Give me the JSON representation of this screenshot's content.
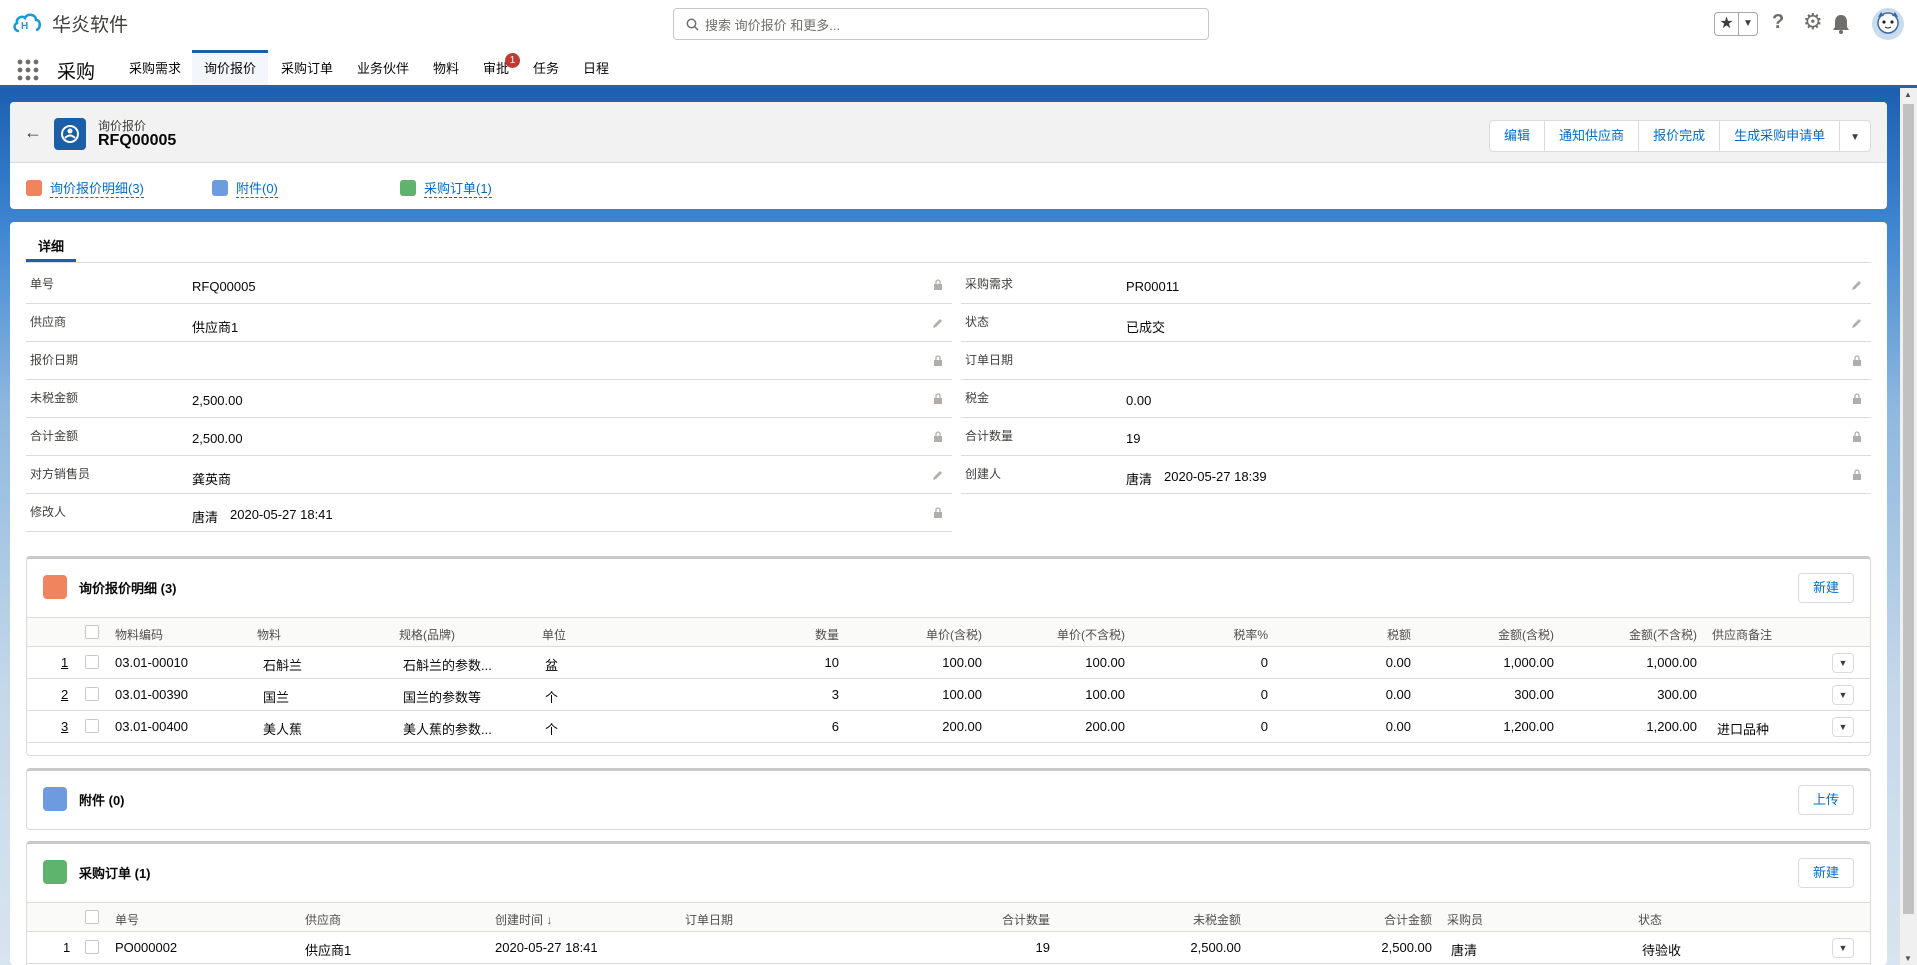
{
  "app": {
    "logo_text": "华炎软件",
    "search_placeholder": "搜索 询价报价 和更多...",
    "name": "采购"
  },
  "nav": {
    "tabs": [
      {
        "label": "采购需求"
      },
      {
        "label": "询价报价"
      },
      {
        "label": "采购订单"
      },
      {
        "label": "业务伙伴"
      },
      {
        "label": "物料"
      },
      {
        "label": "审批"
      },
      {
        "label": "任务"
      },
      {
        "label": "日程"
      }
    ],
    "approval_badge": "1"
  },
  "record": {
    "type": "询价报价",
    "title": "RFQ00005",
    "actions": [
      "编辑",
      "通知供应商",
      "报价完成",
      "生成采购申请单"
    ],
    "related_links": [
      "询价报价明细(3)",
      "附件(0)",
      "采购订单(1)"
    ]
  },
  "detail": {
    "tab": "详细",
    "left": [
      {
        "label": "单号",
        "value": "RFQ00005"
      },
      {
        "label": "供应商",
        "value": "供应商1"
      },
      {
        "label": "报价日期",
        "value": ""
      },
      {
        "label": "未税金额",
        "value": "2,500.00"
      },
      {
        "label": "合计金额",
        "value": "2,500.00"
      },
      {
        "label": "对方销售员",
        "value": "龚英商"
      },
      {
        "label": "修改人",
        "value": "唐清",
        "extra": "2020-05-27 18:41"
      }
    ],
    "right": [
      {
        "label": "采购需求",
        "value": "PR00011"
      },
      {
        "label": "状态",
        "value": "已成交"
      },
      {
        "label": "订单日期",
        "value": ""
      },
      {
        "label": "税金",
        "value": "0.00"
      },
      {
        "label": "合计数量",
        "value": "19"
      },
      {
        "label": "创建人",
        "value": "唐清",
        "extra": "2020-05-27 18:39"
      }
    ]
  },
  "rfq_lines": {
    "title": "询价报价明细 (3)",
    "new_button": "新建",
    "columns": [
      "物料编码",
      "物料",
      "规格(品牌)",
      "单位",
      "数量",
      "单价(含税)",
      "单价(不含税)",
      "税率%",
      "税额",
      "金额(含税)",
      "金额(不含税)",
      "供应商备注"
    ],
    "rows": [
      {
        "idx": "1",
        "code": "03.01-00010",
        "item": "石斛兰",
        "spec": "石斛兰的参数...",
        "unit": "盆",
        "qty": "10",
        "price_tax": "100.00",
        "price": "100.00",
        "rate": "0",
        "tax": "0.00",
        "amt_tax": "1,000.00",
        "amt": "1,000.00",
        "note": ""
      },
      {
        "idx": "2",
        "code": "03.01-00390",
        "item": "国兰",
        "spec": "国兰的参数等",
        "unit": "个",
        "qty": "3",
        "price_tax": "100.00",
        "price": "100.00",
        "rate": "0",
        "tax": "0.00",
        "amt_tax": "300.00",
        "amt": "300.00",
        "note": ""
      },
      {
        "idx": "3",
        "code": "03.01-00400",
        "item": "美人蕉",
        "spec": "美人蕉的参数...",
        "unit": "个",
        "qty": "6",
        "price_tax": "200.00",
        "price": "200.00",
        "rate": "0",
        "tax": "0.00",
        "amt_tax": "1,200.00",
        "amt": "1,200.00",
        "note": "进口品种"
      }
    ]
  },
  "attachments": {
    "title": "附件 (0)",
    "upload_button": "上传"
  },
  "purchase_orders": {
    "title": "采购订单 (1)",
    "new_button": "新建",
    "columns": [
      "单号",
      "供应商",
      "创建时间 ↓",
      "订单日期",
      "合计数量",
      "未税金额",
      "合计金额",
      "采购员",
      "状态"
    ],
    "rows": [
      {
        "idx": "1",
        "no": "PO000002",
        "supplier": "供应商1",
        "created": "2020-05-27 18:41",
        "order_date": "",
        "qty": "19",
        "untaxed": "2,500.00",
        "total": "2,500.00",
        "buyer": "唐清",
        "status": "待验收"
      }
    ]
  },
  "colors": {
    "brand": "#1b5fad",
    "link": "#006dcc",
    "badge": "#c23934",
    "lines_icon": "#f0845f",
    "attach_icon": "#6c9be0",
    "po_icon": "#5eb46c"
  }
}
